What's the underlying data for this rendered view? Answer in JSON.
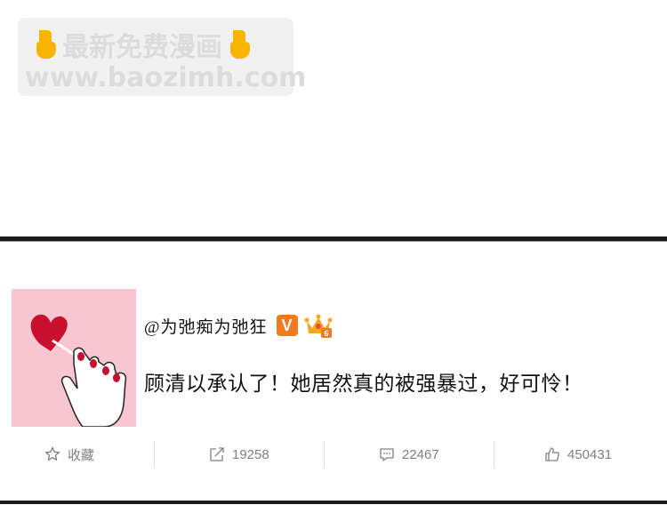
{
  "watermark": {
    "title": "最新免费漫画",
    "url": "www.baozimh.com",
    "icon_left": "pointing-hand-icon",
    "icon_right": "pointing-hand-icon"
  },
  "post": {
    "username": "@为弛痴为弛狂",
    "verified_badge": "V",
    "crown_badge_icon": "crown-icon",
    "text": "顾清以承认了！她居然真的被强暴过，好可怜！",
    "avatar_icon": "lollipop-hand-icon"
  },
  "actions": {
    "favorite_label": "收藏",
    "repost_count": "19258",
    "comment_count": "22467",
    "like_count": "450431"
  },
  "colors": {
    "accent_orange": "#f07a20",
    "avatar_pink": "#f7c6d0",
    "action_gray": "#808080"
  }
}
